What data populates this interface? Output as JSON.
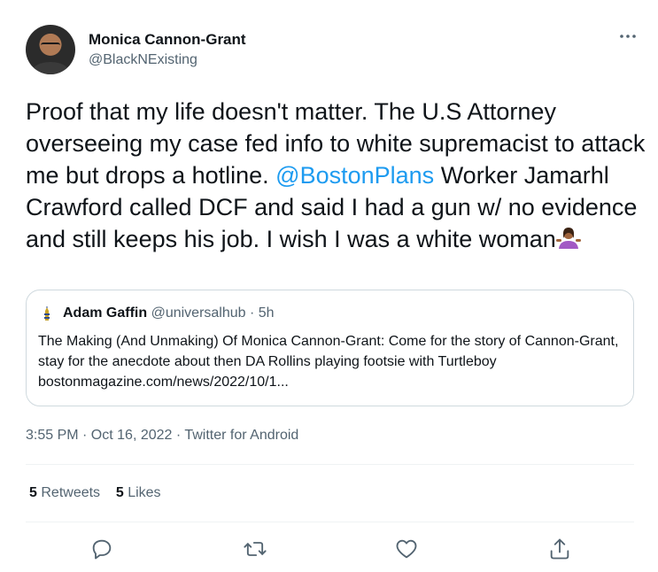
{
  "author": {
    "display_name": "Monica Cannon-Grant",
    "handle": "@BlackNExisting"
  },
  "tweet": {
    "text_part1": "Proof that my life doesn't matter. The U.S Attorney overseeing my case fed info to white supremacist to attack me but drops a hotline. ",
    "mention": "@BostonPlans",
    "text_part2": " Worker Jamarhl Crawford called DCF and said I had a gun w/ no evidence and still keeps his job. I wish I was a white woman",
    "emoji": "person-shrugging-emoji"
  },
  "quoted_tweet": {
    "name": "Adam Gaffin",
    "handle": "@universalhub",
    "separator": "·",
    "time": "5h",
    "text": "The Making (And Unmaking) Of Monica Cannon-Grant: Come for the story of Cannon-Grant, stay for the anecdote about then DA Rollins playing footsie with Turtleboy bostonmagazine.com/news/2022/10/1..."
  },
  "timestamp": "3:55 PM · Oct 16, 2022 · Twitter for Android",
  "stats": {
    "retweets_count": "5",
    "retweets_label": "Retweets",
    "likes_count": "5",
    "likes_label": "Likes"
  },
  "colors": {
    "link": "#1d9bf0",
    "secondary_text": "#536471",
    "border": "#cfd9de"
  },
  "actions": [
    "reply-icon",
    "retweet-icon",
    "like-icon",
    "share-icon"
  ]
}
